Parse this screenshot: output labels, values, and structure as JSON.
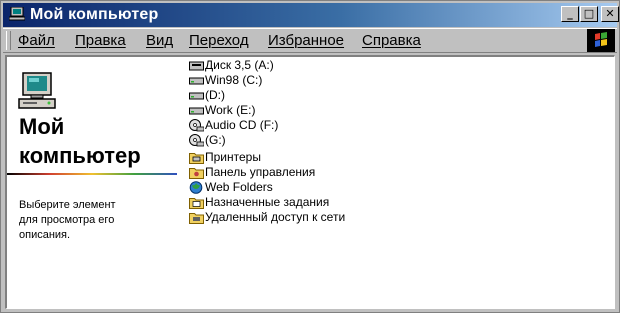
{
  "window": {
    "title": "Мой компьютер"
  },
  "titlebar": {
    "min_glyph": "_",
    "max_glyph": "□",
    "close_glyph": "✕"
  },
  "menu": {
    "items": [
      {
        "label": "Файл"
      },
      {
        "label": "Правка"
      },
      {
        "label": "Вид"
      },
      {
        "label": "Переход"
      },
      {
        "label": "Избранное"
      },
      {
        "label": "Справка"
      }
    ]
  },
  "left_pane": {
    "title_line1": "Мой",
    "title_line2": "компьютер",
    "description_line1": "Выберите элемент",
    "description_line2": "для просмотра его",
    "description_line3": "описания."
  },
  "items": [
    {
      "label": "Диск 3,5 (A:)",
      "icon": "floppy-drive-icon"
    },
    {
      "label": "Win98 (C:)",
      "icon": "hard-drive-icon"
    },
    {
      "label": "(D:)",
      "icon": "hard-drive-icon"
    },
    {
      "label": "Work (E:)",
      "icon": "hard-drive-icon"
    },
    {
      "label": "Audio CD (F:)",
      "icon": "cd-drive-icon"
    },
    {
      "label": "(G:)",
      "icon": "cd-drive-icon"
    },
    {
      "label": "Принтеры",
      "icon": "printers-folder-icon"
    },
    {
      "label": "Панель управления",
      "icon": "control-panel-icon"
    },
    {
      "label": "Web Folders",
      "icon": "web-folders-icon"
    },
    {
      "label": "Назначенные задания",
      "icon": "scheduled-tasks-icon"
    },
    {
      "label": "Удаленный доступ к сети",
      "icon": "dial-up-networking-icon"
    }
  ],
  "colors": {
    "titlebar_start": "#0a246a",
    "titlebar_end": "#a6caf0",
    "window_face": "#c0c0c0",
    "content_bg": "#ffffff"
  }
}
